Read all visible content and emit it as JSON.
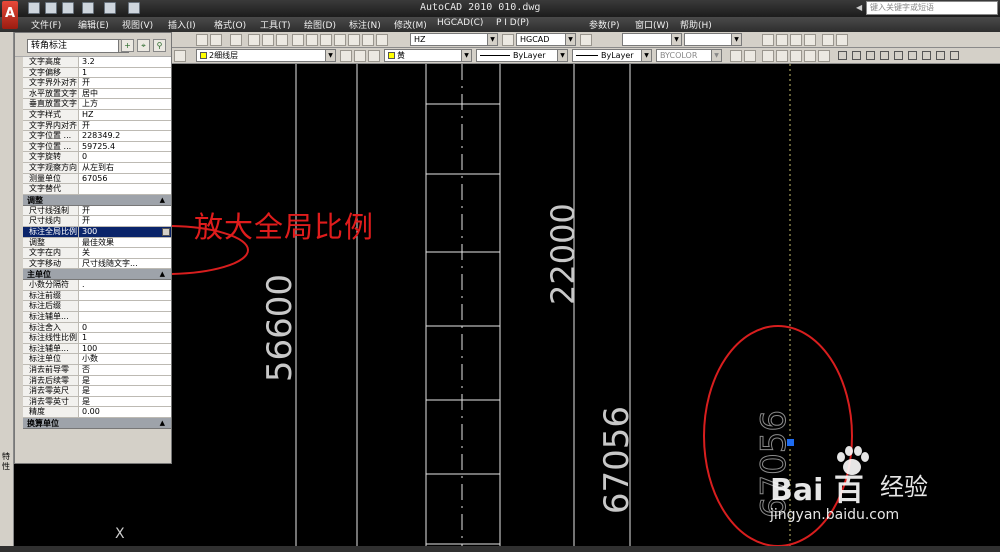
{
  "title_bar": {
    "window_title": "AutoCAD 2010   010.dwg",
    "search_placeholder": "键入关键字或短语"
  },
  "menu": [
    "文件(F)",
    "编辑(E)",
    "视图(V)",
    "插入(I)",
    "格式(O)",
    "工具(T)",
    "绘图(D)",
    "标注(N)",
    "修改(M)",
    "HGCAD(C)",
    "P I D(P)",
    "参数(P)",
    "窗口(W)",
    "帮助(H)"
  ],
  "toolbar": {
    "layer_name": "2细线层",
    "text_style": "HZ",
    "dim_style": "HGCAD",
    "color": "黄",
    "linetype": "ByLayer",
    "lineweight": "ByLayer",
    "plotstyle": "BYCOLOR"
  },
  "colors": {
    "swatches": [
      "#ff0000",
      "#ffff00",
      "#00ff00",
      "#00ffff",
      "#0000ff",
      "#ff00ff",
      "#ffffff",
      "#808080",
      "#c0c0c0"
    ],
    "annotation": "#e01c1c",
    "highlight": "#0a246a"
  },
  "side_strip_label": "特性",
  "properties": {
    "object_type": "转角标注",
    "rows_text": [
      {
        "k": "文字高度",
        "v": "3.2"
      },
      {
        "k": "文字偏移",
        "v": "1"
      },
      {
        "k": "文字界外对齐",
        "v": "开"
      },
      {
        "k": "水平放置文字",
        "v": "居中"
      },
      {
        "k": "垂直放置文字",
        "v": "上方"
      },
      {
        "k": "文字样式",
        "v": "HZ"
      },
      {
        "k": "文字界内对齐",
        "v": "开"
      },
      {
        "k": "文字位置 ...",
        "v": "228349.2"
      },
      {
        "k": "文字位置 ...",
        "v": "59725.4"
      },
      {
        "k": "文字旋转",
        "v": "0"
      },
      {
        "k": "文字观察方向",
        "v": "从左到右"
      },
      {
        "k": "测量单位",
        "v": "67056"
      },
      {
        "k": "文字替代",
        "v": ""
      }
    ],
    "section_adjust": "调整",
    "rows_adjust": [
      {
        "k": "尺寸线强制",
        "v": "开"
      },
      {
        "k": "尺寸线内",
        "v": "开"
      },
      {
        "k": "标注全局比例",
        "v": "300",
        "hl": true
      },
      {
        "k": "调整",
        "v": "最佳效果"
      },
      {
        "k": "文字在内",
        "v": "关"
      },
      {
        "k": "文字移动",
        "v": "尺寸线随文字..."
      }
    ],
    "section_primary": "主单位",
    "rows_primary": [
      {
        "k": "小数分隔符",
        "v": "."
      },
      {
        "k": "标注前缀",
        "v": ""
      },
      {
        "k": "标注后缀",
        "v": ""
      },
      {
        "k": "标注辅单...",
        "v": ""
      },
      {
        "k": "标注舍入",
        "v": "0"
      },
      {
        "k": "标注线性比例",
        "v": "1"
      },
      {
        "k": "标注辅单...",
        "v": "100"
      },
      {
        "k": "标注单位",
        "v": "小数"
      },
      {
        "k": "消去前导零",
        "v": "否"
      },
      {
        "k": "消去后续零",
        "v": "是"
      },
      {
        "k": "消去零英尺",
        "v": "是"
      },
      {
        "k": "消去零英寸",
        "v": "是"
      },
      {
        "k": "精度",
        "v": "0.00"
      }
    ],
    "section_alt": "换算单位"
  },
  "drawing": {
    "dims": [
      "56600",
      "22000",
      "67056",
      "67056"
    ],
    "annotation": "放大全局比例",
    "ucs_x": "X"
  },
  "watermark": {
    "brand": "Bai  百",
    "jy": "经验",
    "url": "jingyan.baidu.com"
  }
}
